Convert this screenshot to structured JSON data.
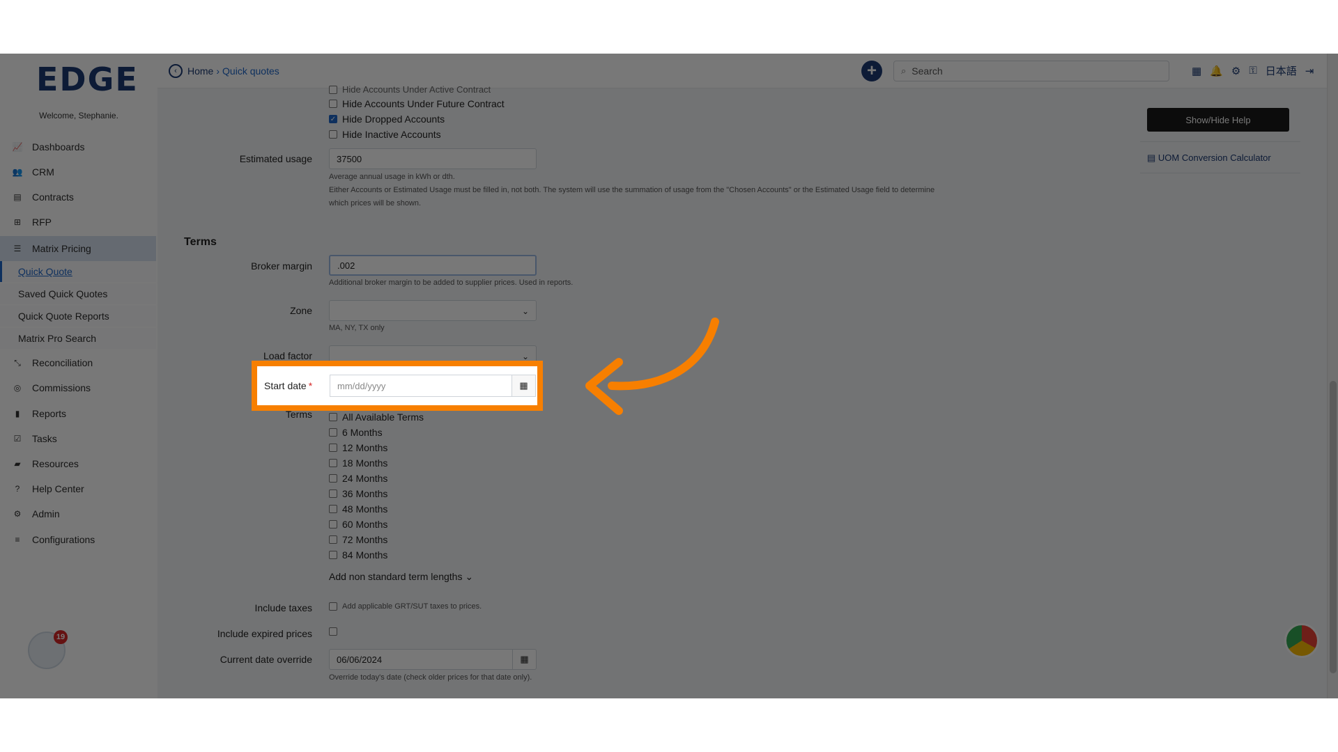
{
  "brand": {
    "logo": "EDGE",
    "welcome": "Welcome, Stephanie."
  },
  "sidebar": {
    "items": [
      {
        "label": "Dashboards",
        "icon": "chart-line-icon"
      },
      {
        "label": "CRM",
        "icon": "users-icon"
      },
      {
        "label": "Contracts",
        "icon": "document-icon"
      },
      {
        "label": "RFP",
        "icon": "sitemap-icon"
      },
      {
        "label": "Matrix Pricing",
        "icon": "list-icon"
      },
      {
        "label": "Reconciliation",
        "icon": "compress-icon"
      },
      {
        "label": "Commissions",
        "icon": "coins-icon"
      },
      {
        "label": "Reports",
        "icon": "bar-chart-icon"
      },
      {
        "label": "Tasks",
        "icon": "tasks-icon"
      },
      {
        "label": "Resources",
        "icon": "folder-icon"
      },
      {
        "label": "Help Center",
        "icon": "question-icon"
      },
      {
        "label": "Admin",
        "icon": "cogs-icon"
      },
      {
        "label": "Configurations",
        "icon": "sliders-icon"
      }
    ],
    "subitems": [
      {
        "label": "Quick Quote"
      },
      {
        "label": "Saved Quick Quotes"
      },
      {
        "label": "Quick Quote Reports"
      },
      {
        "label": "Matrix Pro Search"
      }
    ],
    "notification_count": "19"
  },
  "topbar": {
    "breadcrumb_home": "Home",
    "breadcrumb_sep": "›",
    "breadcrumb_current": "Quick quotes",
    "search_placeholder": "Search",
    "language": "日本語"
  },
  "form": {
    "hide_cut": "Hide Accounts Under Active Contract",
    "hide_options": [
      {
        "label": "Hide Accounts Under Future Contract",
        "checked": false
      },
      {
        "label": "Hide Dropped Accounts",
        "checked": true
      },
      {
        "label": "Hide Inactive Accounts",
        "checked": false
      }
    ],
    "estimated_usage_label": "Estimated usage",
    "estimated_usage_value": "37500",
    "estimated_usage_help1": "Average annual usage in kWh or dth.",
    "estimated_usage_help2": "Either Accounts or Estimated Usage must be filled in, not both. The system will use the summation of usage from the \"Chosen Accounts\" or the Estimated Usage field to determine",
    "estimated_usage_help3": "which prices will be shown.",
    "terms_section_title": "Terms",
    "broker_margin_label": "Broker margin",
    "broker_margin_value": ".002",
    "broker_margin_help": "Additional broker margin to be added to supplier prices. Used in reports.",
    "zone_label": "Zone",
    "zone_help": "MA, NY, TX only",
    "load_factor_label": "Load factor",
    "start_date_label": "Start date",
    "start_date_required": "*",
    "start_date_placeholder": "mm/dd/yyyy",
    "terms_label": "Terms",
    "terms_options": [
      "All Available Terms",
      "6 Months",
      "12 Months",
      "18 Months",
      "24 Months",
      "36 Months",
      "48 Months",
      "60 Months",
      "72 Months",
      "84 Months"
    ],
    "add_non_standard": "Add non standard term lengths",
    "include_taxes_label": "Include taxes",
    "include_taxes_help": "Add applicable GRT/SUT taxes to prices.",
    "include_expired_label": "Include expired prices",
    "current_date_label": "Current date override",
    "current_date_value": "06/06/2024",
    "current_date_help": "Override today's date (check older prices for that date only)."
  },
  "right_panel": {
    "show_hide_help": "Show/Hide Help",
    "uom_calculator": "UOM Conversion Calculator"
  },
  "colors": {
    "brand": "#1c3a73",
    "link": "#1e66c8",
    "highlight": "#f77f00"
  }
}
